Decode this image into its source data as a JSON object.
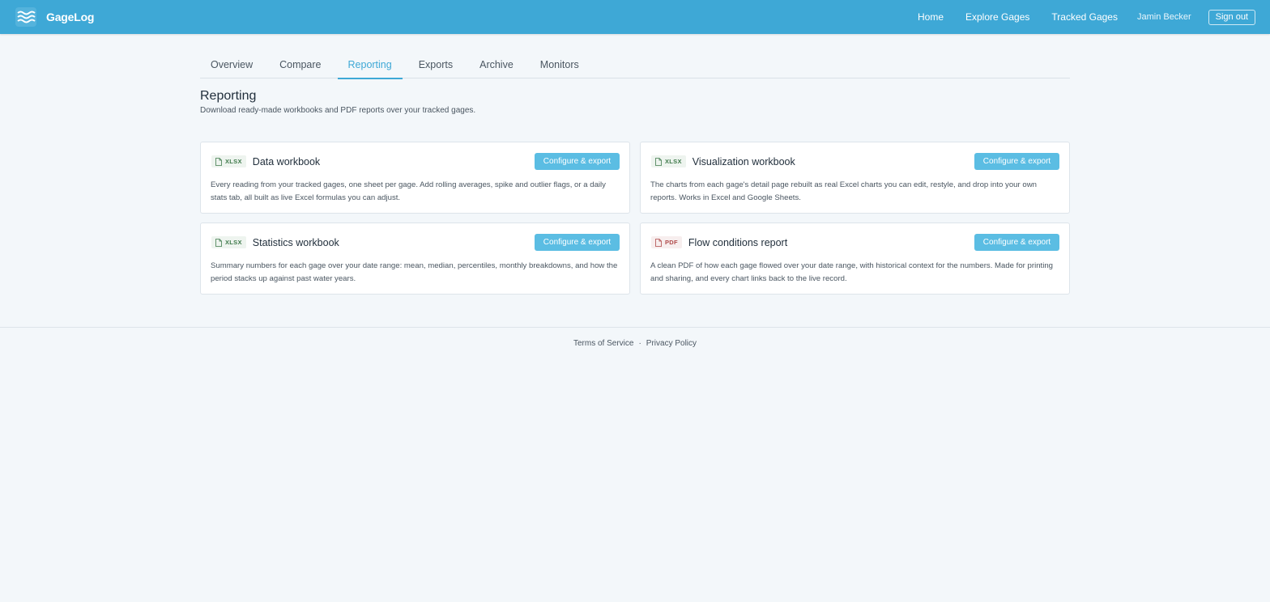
{
  "header": {
    "brand": "GageLog",
    "nav": [
      "Home",
      "Explore Gages",
      "Tracked Gages"
    ],
    "user": "Jamin Becker",
    "sign_out": "Sign out"
  },
  "tabs": [
    {
      "label": "Overview",
      "active": false
    },
    {
      "label": "Compare",
      "active": false
    },
    {
      "label": "Reporting",
      "active": true
    },
    {
      "label": "Exports",
      "active": false
    },
    {
      "label": "Archive",
      "active": false
    },
    {
      "label": "Monitors",
      "active": false
    }
  ],
  "page": {
    "title": "Reporting",
    "subtitle": "Download ready-made workbooks and PDF reports over your tracked gages."
  },
  "cards": [
    {
      "badge": "XLSX",
      "title": "Data workbook",
      "button": "Configure & export",
      "description": "Every reading from your tracked gages, one sheet per gage. Add rolling averages, spike and outlier flags, or a daily stats tab, all built as live Excel formulas you can adjust."
    },
    {
      "badge": "XLSX",
      "title": "Visualization workbook",
      "button": "Configure & export",
      "description": "The charts from each gage's detail page rebuilt as real Excel charts you can edit, restyle, and drop into your own reports. Works in Excel and Google Sheets."
    },
    {
      "badge": "XLSX",
      "title": "Statistics workbook",
      "button": "Configure & export",
      "description": "Summary numbers for each gage over your date range: mean, median, percentiles, monthly breakdowns, and how the period stacks up against past water years."
    },
    {
      "badge": "PDF",
      "title": "Flow conditions report",
      "button": "Configure & export",
      "description": "A clean PDF of how each gage flowed over your date range, with historical context for the numbers. Made for printing and sharing, and every chart links back to the live record."
    }
  ],
  "footer": {
    "terms": "Terms of Service",
    "separator": "·",
    "privacy": "Privacy Policy"
  },
  "colors": {
    "brand_blue": "#3ea8d6",
    "button_blue": "#5bbde3",
    "xlsx_green": "#3f7a4b",
    "pdf_red": "#b04a4a"
  },
  "icons": {
    "brand": "waves-logo-icon",
    "file_badge": "file-icon"
  }
}
